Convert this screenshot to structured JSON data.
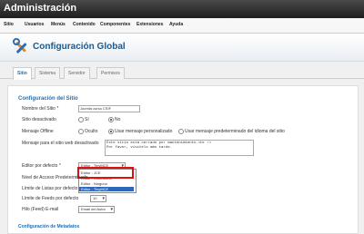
{
  "app": {
    "title": "Administración"
  },
  "menu": [
    "Sitio",
    "Usuarios",
    "Menús",
    "Contenido",
    "Componentes",
    "Extensiones",
    "Ayuda"
  ],
  "header": {
    "title": "Configuración Global",
    "icon": "tools-icon"
  },
  "tabs": [
    "Sitio",
    "Sistema",
    "Servidor",
    "Permisos"
  ],
  "section": {
    "title": "Configuración del Sitio"
  },
  "form": {
    "site_name": {
      "label": "Nombre del Sitio *",
      "value": "Joomla curso CSIF"
    },
    "site_offline": {
      "label": "Sitio desactivado",
      "options": [
        "Sí",
        "No"
      ],
      "selected": 1
    },
    "offline_message": {
      "label": "Mensaje Offline",
      "options": [
        "Oculto",
        "Usar mensaje personalizado",
        "Usar mensaje predeterminado del idioma del sitio"
      ],
      "selected": 1
    },
    "offline_text": {
      "label": "Mensaje para el sitio web desactivado",
      "value": "Este sitio está cerrado por mantenimiento.<br />\nPor favor, visítelo más tarde."
    },
    "editor": {
      "label": "Editor por defecto *",
      "value": "Editor - TinyMCE"
    },
    "access": {
      "label": "Nivel de Acceso Predeterminado"
    },
    "list_limit": {
      "label": "Límite de Listas por defecto"
    },
    "feed_limit": {
      "label": "Límite de Feeds por defecto",
      "value": "10"
    },
    "feed_email": {
      "label": "Hilo (Feed) E-mail",
      "value": "Email del Autor"
    }
  },
  "editor_dropdown": {
    "items": [
      "Editor - JCE",
      "Editor - CodeMirror",
      "Editor - Ninguno",
      "Editor - TinyMCE"
    ],
    "selected_index": 3
  },
  "bottom_section": {
    "title": "Configuración de Metadatos"
  },
  "colors": {
    "accent": "#1f6fb6",
    "highlight_box": "#e01010",
    "selection": "#2e66b8"
  }
}
